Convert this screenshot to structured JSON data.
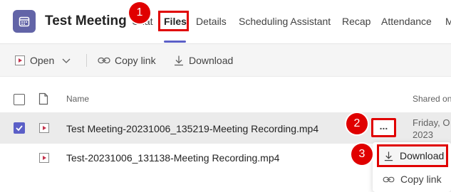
{
  "header": {
    "title": "Test Meeting",
    "tabs": [
      "Chat",
      "Files",
      "Details",
      "Scheduling Assistant",
      "Recap",
      "Attendance",
      "M"
    ],
    "active_tab": "Files",
    "accent_color": "#5b5fc7",
    "app_icon": "calendar-icon"
  },
  "toolbar": {
    "open_label": "Open",
    "copy_link_label": "Copy link",
    "download_label": "Download"
  },
  "table": {
    "columns": [
      "Name",
      "Shared on"
    ],
    "rows": [
      {
        "name": "Test Meeting-20231006_135219-Meeting Recording.mp4",
        "shared_line1": "Friday, O",
        "shared_line2": "2023",
        "selected": true
      },
      {
        "name": "Test-20231006_131138-Meeting Recording.mp4",
        "shared_line1": "",
        "shared_line2": "",
        "selected": false
      }
    ],
    "more_label": "..."
  },
  "context_menu": {
    "items": [
      "Download",
      "Copy link"
    ]
  },
  "annotations": {
    "step1": "1",
    "step2": "2",
    "step3": "3",
    "highlight_color": "#e00000"
  }
}
